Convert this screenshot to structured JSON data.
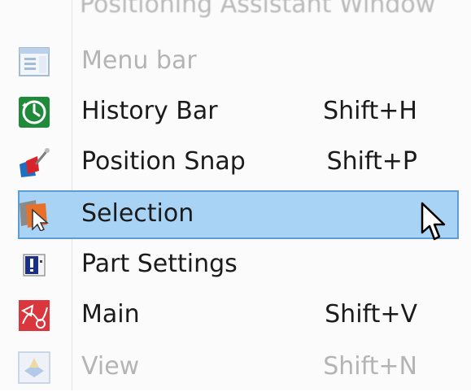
{
  "menu": {
    "top_partial_label": "Positioning Assistant Window",
    "items": [
      {
        "label": "Menu bar",
        "shortcut": "",
        "icon": "menu-bar-icon",
        "state": "dim"
      },
      {
        "label": "History Bar",
        "shortcut": "Shift+H",
        "icon": "history-clock-icon",
        "state": "normal"
      },
      {
        "label": "Position Snap",
        "shortcut": "Shift+P",
        "icon": "position-snap-icon",
        "state": "normal"
      },
      {
        "label": "Selection",
        "shortcut": "",
        "icon": "selection-arrow-icon",
        "state": "selected"
      },
      {
        "label": "Part Settings",
        "shortcut": "",
        "icon": "part-settings-icon",
        "state": "normal"
      },
      {
        "label": "Main",
        "shortcut": "Shift+V",
        "icon": "main-toolbar-icon",
        "state": "normal"
      },
      {
        "label": "View",
        "shortcut": "Shift+N",
        "icon": "view-icon",
        "state": "dim"
      }
    ]
  },
  "colors": {
    "highlight_fill": "#a9d3f5",
    "highlight_border": "#5c9fd6",
    "text": "#1b1b1b",
    "disabled_text": "#b4b4b4"
  }
}
